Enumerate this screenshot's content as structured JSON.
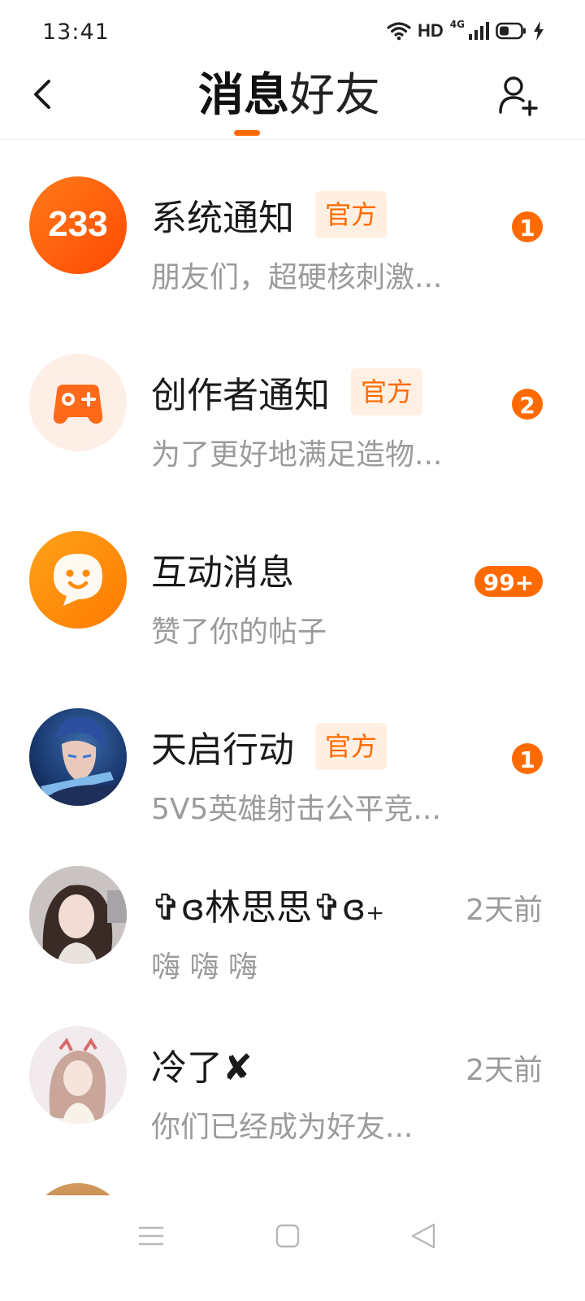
{
  "status_bar": {
    "time": "13:41",
    "hd": "HD",
    "network": "4G",
    "icons": [
      "wifi-icon",
      "signal-icon",
      "battery-icon",
      "charging-icon"
    ]
  },
  "header": {
    "tabs": [
      {
        "label": "消息",
        "active": true
      },
      {
        "label": "好友",
        "active": false
      }
    ],
    "accent_color": "#ff6a00",
    "icons": {
      "back": "chevron-left-icon",
      "add_friend": "add-friend-icon"
    }
  },
  "conversations": [
    {
      "name": "系统通知",
      "official": true,
      "official_label": "官方",
      "preview": "朋友们，超硬核刺激...",
      "unread": "1",
      "avatar_text": "233",
      "avatar_icon": "233-logo-icon"
    },
    {
      "name": "创作者通知",
      "official": true,
      "official_label": "官方",
      "preview": "为了更好地满足造物...",
      "unread": "2",
      "avatar_icon": "gamepad-icon"
    },
    {
      "name": "互动消息",
      "official": false,
      "preview": "赞了你的帖子",
      "unread": "99+",
      "avatar_icon": "smile-chat-icon"
    },
    {
      "name": "天启行动",
      "official": true,
      "official_label": "官方",
      "preview": "5V5英雄射击公平竞...",
      "unread": "1",
      "avatar_icon": "game-hero-avatar"
    },
    {
      "name": "✞ɞ林思思✞ɞ₊",
      "official": false,
      "preview": "嗨 嗨 嗨",
      "time": "2天前",
      "avatar_icon": "user-photo-avatar"
    },
    {
      "name": "冷了✘",
      "official": false,
      "preview": "你们已经成为好友...",
      "time": "2天前",
      "avatar_icon": "user-photo-avatar"
    }
  ],
  "nav_bar": {
    "icons": [
      "menu-icon",
      "home-square-icon",
      "back-triangle-icon"
    ]
  }
}
